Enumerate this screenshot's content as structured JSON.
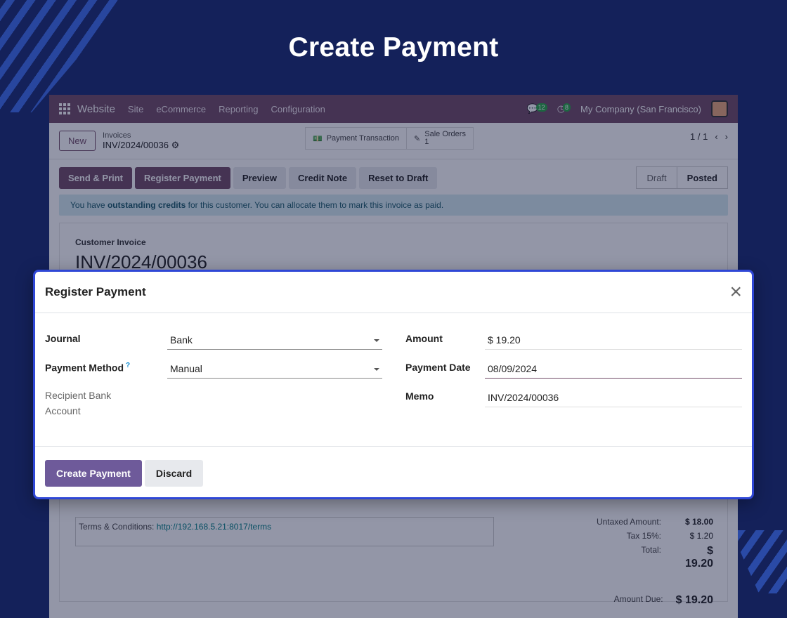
{
  "hero": {
    "title": "Create Payment"
  },
  "navbar": {
    "app_name": "Website",
    "menu": [
      "Site",
      "eCommerce",
      "Reporting",
      "Configuration"
    ],
    "messages_count": "12",
    "activities_count": "8",
    "company": "My Company (San Francisco)"
  },
  "control": {
    "new_label": "New",
    "breadcrumb_parent": "Invoices",
    "breadcrumb_current": "INV/2024/00036",
    "smart_buttons": [
      {
        "label": "Payment Transaction",
        "icon": "money-icon"
      },
      {
        "label": "Sale Orders",
        "count": "1",
        "icon": "edit-icon"
      }
    ],
    "pager": "1 / 1"
  },
  "actions": [
    "Send & Print",
    "Register Payment",
    "Preview",
    "Credit Note",
    "Reset to Draft"
  ],
  "status": {
    "draft": "Draft",
    "posted": "Posted"
  },
  "alert": {
    "before": "You have ",
    "bold": "outstanding credits",
    "after": " for this customer. You can allocate them to mark this invoice as paid."
  },
  "sheet": {
    "label": "Customer Invoice",
    "number": "INV/2024/00036",
    "terms_label": "Terms & Conditions: ",
    "terms_link": "http://192.168.5.21:8017/terms",
    "untaxed_label": "Untaxed Amount:",
    "untaxed_value": "$ 18.00",
    "tax_label": "Tax 15%:",
    "tax_value": "$ 1.20",
    "total_label": "Total:",
    "total_value": "$ 19.20",
    "amount_due_label": "Amount Due:",
    "amount_due_value": "$ 19.20"
  },
  "modal": {
    "title": "Register Payment",
    "close": "×",
    "journal_label": "Journal",
    "journal_value": "Bank",
    "method_label": "Payment Method",
    "method_help": "?",
    "method_value": "Manual",
    "recipient_label_1": "Recipient Bank",
    "recipient_label_2": "Account",
    "amount_label": "Amount",
    "amount_value": "$ 19.20",
    "date_label": "Payment Date",
    "date_value": "08/09/2024",
    "memo_label": "Memo",
    "memo_value": "INV/2024/00036",
    "create_label": "Create Payment",
    "discard_label": "Discard"
  },
  "colors": {
    "background": "#14215a",
    "brand": "#714b67",
    "primary_button": "#6e5a9a",
    "modal_border": "#2f47d6"
  }
}
